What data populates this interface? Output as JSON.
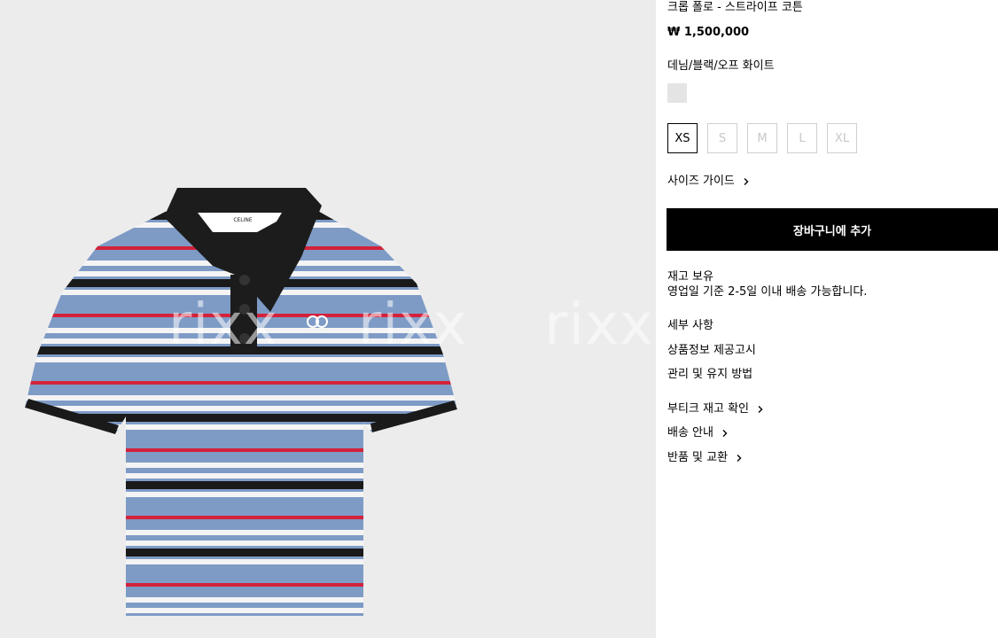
{
  "product": {
    "title": "크롭 폴로 - 스트라이프 코튼",
    "price": "₩ 1,500,000",
    "color_name": "데님/블랙/오프 화이트",
    "collar_label": "CELINE",
    "watermark": "rixx"
  },
  "sizes": [
    {
      "label": "XS",
      "state": "selected"
    },
    {
      "label": "S",
      "state": "unavailable"
    },
    {
      "label": "M",
      "state": "unavailable"
    },
    {
      "label": "L",
      "state": "unavailable"
    },
    {
      "label": "XL",
      "state": "unavailable"
    }
  ],
  "size_guide_label": "사이즈 가이드",
  "add_to_cart_label": "장바구니에 추가",
  "stock": {
    "status": "재고 보유",
    "delivery": "영업일 기준 2-5일 이내 배송 가능합니다."
  },
  "details": {
    "details_label": "세부 사항",
    "product_info_label": "상품정보 제공고시",
    "care_label": "관리 및 유지 방법"
  },
  "services": {
    "boutique_stock_label": "부티크 재고 확인",
    "shipping_label": "배송 안내",
    "returns_label": "반품 및 교환"
  },
  "colors": {
    "stripe_blue": "#7e9bc6",
    "stripe_black": "#1a1a1a",
    "stripe_white": "#f4f4f4",
    "stripe_red": "#d3223a",
    "background": "#ececec"
  },
  "icons": {
    "chevron": "chevron-right-icon"
  }
}
